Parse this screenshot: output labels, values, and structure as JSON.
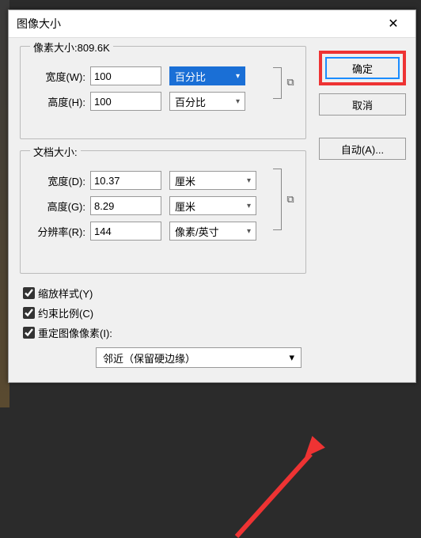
{
  "title": "图像大小",
  "close": "✕",
  "pixelGroup": {
    "legend": "像素大小:809.6K",
    "widthLabel": "宽度(W):",
    "widthValue": "100",
    "widthUnit": "百分比",
    "heightLabel": "高度(H):",
    "heightValue": "100",
    "heightUnit": "百分比"
  },
  "docGroup": {
    "legend": "文档大小:",
    "widthLabel": "宽度(D):",
    "widthValue": "10.37",
    "widthUnit": "厘米",
    "heightLabel": "高度(G):",
    "heightValue": "8.29",
    "heightUnit": "厘米",
    "resLabel": "分辨率(R):",
    "resValue": "144",
    "resUnit": "像素/英寸"
  },
  "checks": {
    "scale": "缩放样式(Y)",
    "constrain": "约束比例(C)",
    "resample": "重定图像像素(I):"
  },
  "resampleMethod": "邻近（保留硬边缘）",
  "buttons": {
    "ok": "确定",
    "cancel": "取消",
    "auto": "自动(A)..."
  },
  "linkIcon": "⇅"
}
